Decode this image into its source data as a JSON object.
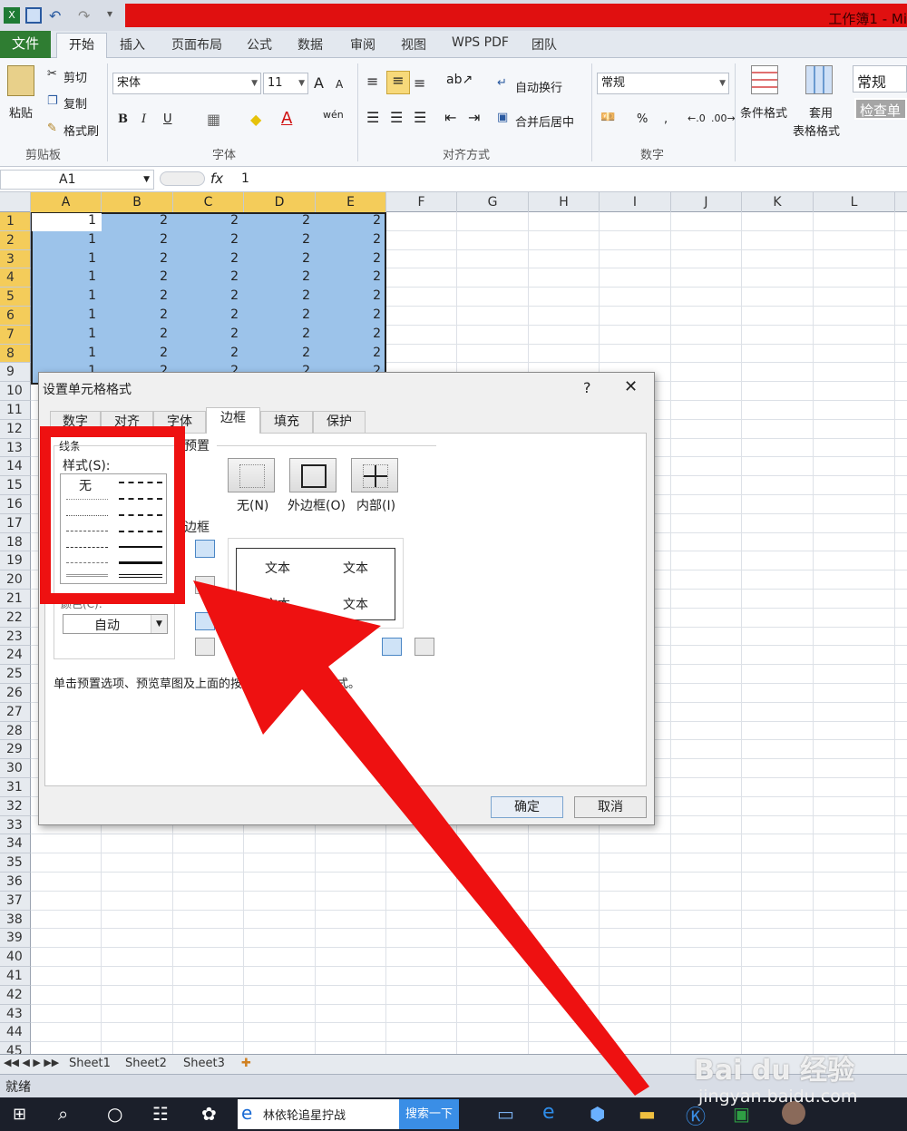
{
  "window": {
    "title": "工作簿1 - Mi"
  },
  "ribbon_tabs": [
    "文件",
    "开始",
    "插入",
    "页面布局",
    "公式",
    "数据",
    "审阅",
    "视图",
    "WPS PDF",
    "团队"
  ],
  "clipboard": {
    "paste": "粘贴",
    "cut": "剪切",
    "copy": "复制",
    "format_painter": "格式刷",
    "group": "剪贴板"
  },
  "font": {
    "name": "宋体",
    "size": "11",
    "group": "字体",
    "bold": "B",
    "italic": "I",
    "underline": "U",
    "grow": "A",
    "shrink": "A",
    "phonetic": "wén"
  },
  "alignment": {
    "wrap": "自动换行",
    "merge": "合并后居中",
    "group": "对齐方式"
  },
  "number": {
    "format": "常规",
    "percent": "%",
    "comma": ",",
    "group": "数字"
  },
  "styles": {
    "conditional": "条件格式",
    "table_line1": "套用",
    "table_line2": "表格格式",
    "normal": "常规",
    "check": "检查单"
  },
  "formula_bar": {
    "name_box": "A1",
    "fx": "fx",
    "value": "1"
  },
  "grid": {
    "columns": [
      "A",
      "B",
      "C",
      "D",
      "E",
      "F",
      "G",
      "H",
      "I",
      "J",
      "K",
      "L"
    ],
    "rows": [
      "1",
      "2",
      "3",
      "4",
      "5",
      "6",
      "7",
      "8",
      "9",
      "10",
      "11",
      "12",
      "13",
      "14",
      "15",
      "16",
      "17",
      "18",
      "19",
      "20",
      "21",
      "22",
      "23",
      "24",
      "25",
      "26",
      "27",
      "28",
      "29",
      "30",
      "31",
      "32",
      "33",
      "34",
      "35",
      "36",
      "37",
      "38",
      "39",
      "40",
      "41",
      "42",
      "43",
      "44",
      "45"
    ],
    "cell_a": "1",
    "cell_other": "2"
  },
  "sheets": [
    "Sheet1",
    "Sheet2",
    "Sheet3"
  ],
  "status": "就绪",
  "dialog": {
    "title": "设置单元格格式",
    "help": "?",
    "close": "✕",
    "tabs": [
      "数字",
      "对齐",
      "字体",
      "边框",
      "填充",
      "保护"
    ],
    "line_group": "线条",
    "style_label": "样式(S):",
    "none_style": "无",
    "color_label": "颜色(C):",
    "color_value": "自动",
    "presets_label": "预置",
    "preset_none": "无(N)",
    "preset_outline": "外边框(O)",
    "preset_inside": "内部(I)",
    "border_label": "边框",
    "preview_text": "文本",
    "hint": "单击预置选项、预览草图及上面的按钮可以添加边框样式。",
    "ok": "确定",
    "cancel": "取消"
  },
  "taskbar": {
    "search_text": "林依轮追星拧战",
    "search_btn": "搜索一下"
  },
  "watermark": {
    "brand": "Bai du 经验",
    "url": "jingyan.baidu.com"
  },
  "colors": {
    "accent_red": "#ee1111",
    "selection": "#9cc3ea",
    "header_sel": "#f4cc5a",
    "file_tab": "#2f7d32"
  }
}
